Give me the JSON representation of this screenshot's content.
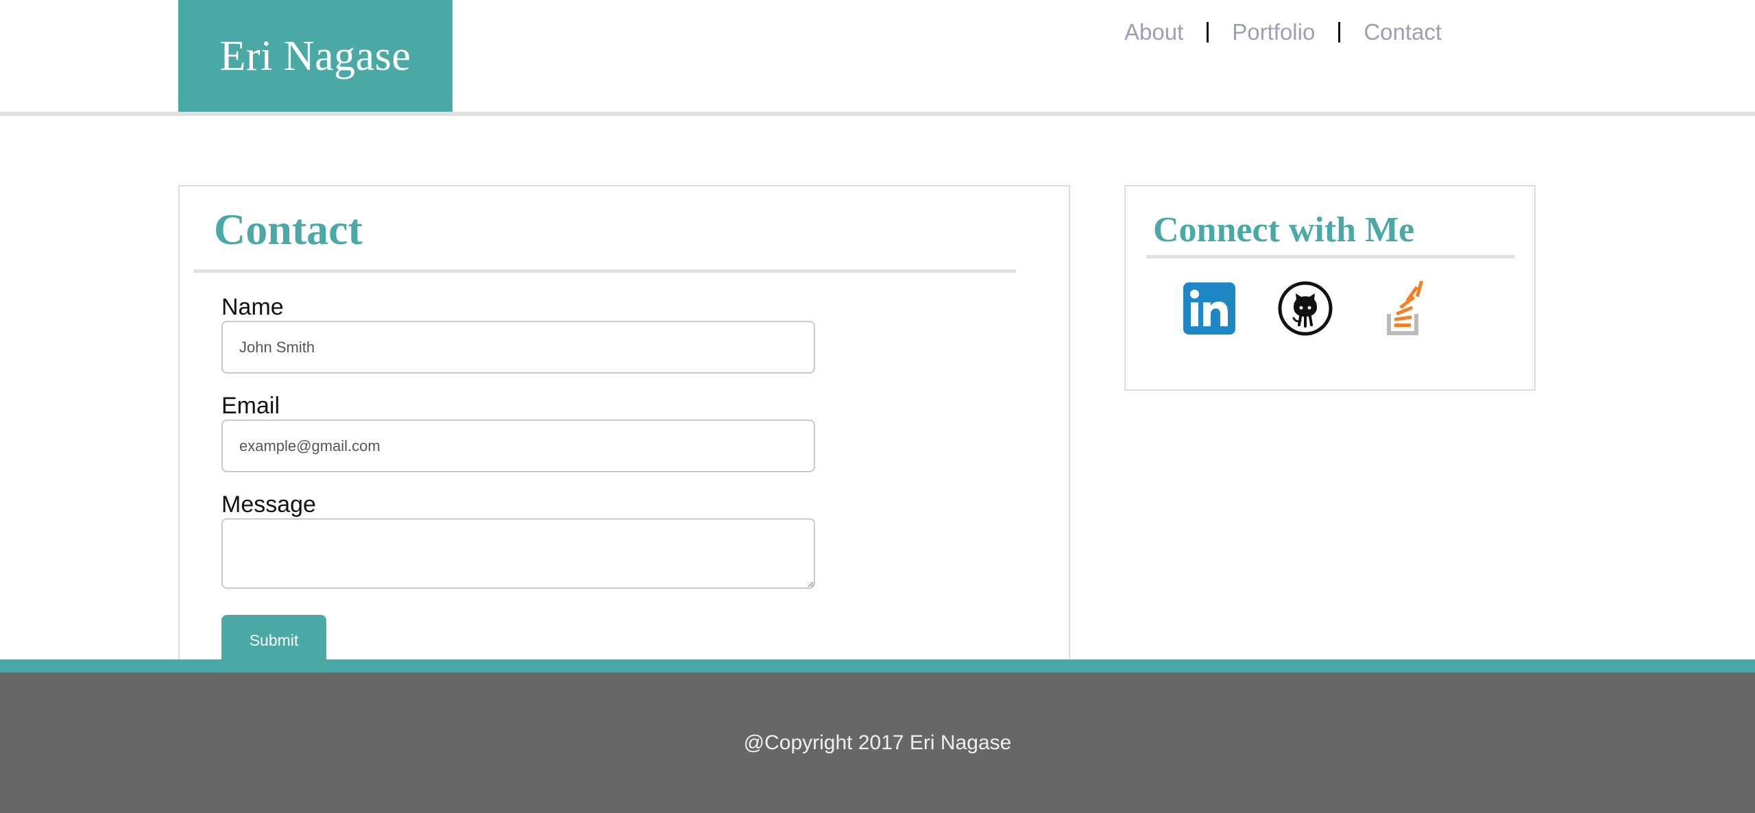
{
  "header": {
    "brand": "Eri Nagase",
    "nav": [
      {
        "label": "About"
      },
      {
        "label": "Portfolio"
      },
      {
        "label": "Contact"
      }
    ]
  },
  "contact": {
    "title": "Contact",
    "name_label": "Name",
    "name_placeholder": "John Smith",
    "email_label": "Email",
    "email_placeholder": "example@gmail.com",
    "message_label": "Message",
    "submit_label": "Submit"
  },
  "connect": {
    "title": "Connect with Me",
    "icons": [
      "linkedin-icon",
      "github-icon",
      "stackoverflow-icon"
    ]
  },
  "footer": {
    "copyright": "@Copyright 2017 Eri Nagase"
  },
  "colors": {
    "accent": "#4aa9a5",
    "nav_link": "#9aa0b4",
    "footer_bg": "#676767",
    "linkedin": "#1e88c7",
    "stackoverflow": "#f48024"
  }
}
